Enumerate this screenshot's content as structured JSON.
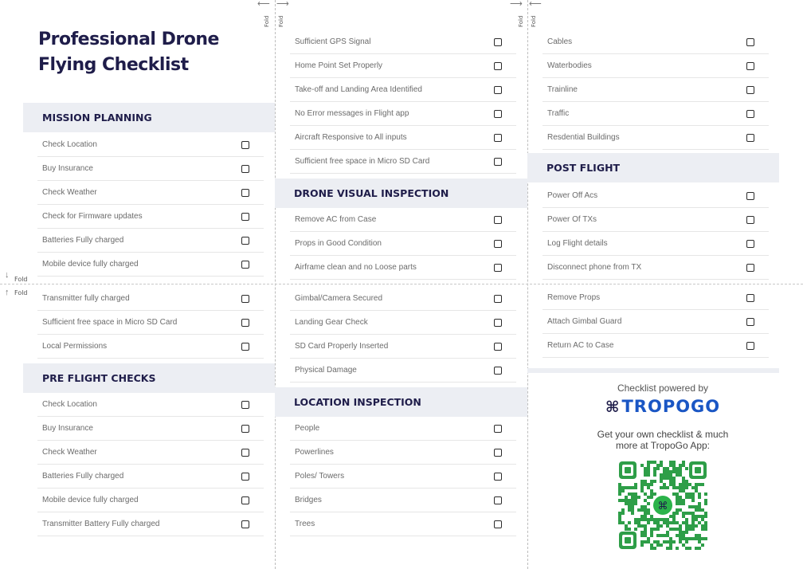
{
  "title": "Professional Drone Flying Checklist",
  "fold_label": "Fold",
  "accent_colors": {
    "title": "#1f1d4a",
    "brand": "#1a56c4",
    "qr": "#2e9e48",
    "qr_center": "#2bb34a"
  },
  "sections": {
    "mission_planning": {
      "heading": "MISSION PLANNING",
      "items": [
        "Check Location",
        "Buy Insurance",
        "Check Weather",
        "Check for Firmware updates",
        "Batteries Fully charged",
        "Mobile device fully charged",
        "Transmitter fully charged",
        "Sufficient free space in Micro SD Card",
        "Local Permissions"
      ]
    },
    "pre_flight": {
      "heading": "PRE FLIGHT CHECKS",
      "items": [
        "Check Location",
        "Buy Insurance",
        "Check Weather",
        "Batteries Fully charged",
        "Mobile device fully charged",
        "Transmitter Battery Fully charged"
      ]
    },
    "pre_flight_continued": {
      "items": [
        "Sufficient GPS Signal",
        "Home Point Set Properly",
        "Take-off and Landing Area Identified",
        "No Error messages in Flight app",
        "Aircraft Responsive to All inputs",
        "Sufficient free space in Micro SD Card"
      ]
    },
    "drone_visual": {
      "heading": "DRONE VISUAL INSPECTION",
      "items": [
        "Remove AC from Case",
        "Props in Good Condition",
        "Airframe clean and no Loose parts",
        "Gimbal/Camera Secured",
        "Landing Gear Check",
        "SD Card Properly Inserted",
        "Physical Damage"
      ]
    },
    "location": {
      "heading": "LOCATION INSPECTION",
      "items": [
        "People",
        "Powerlines",
        "Poles/ Towers",
        "Bridges",
        "Trees"
      ]
    },
    "location_continued": {
      "items": [
        "Cables",
        "Waterbodies",
        "Trainline",
        "Traffic",
        "Resdential Buildings"
      ]
    },
    "post_flight": {
      "heading": "POST FLIGHT",
      "items": [
        "Power Off Acs",
        "Power Of TXs",
        "Log Flight details",
        "Disconnect phone from TX",
        "Remove Props",
        "Attach Gimbal Guard",
        "Return AC to Case"
      ]
    }
  },
  "promo": {
    "powered_by": "Checklist powered by",
    "brand_icon": "⌘",
    "brand_name": "TROPOGO",
    "cta": "Get your own checklist & much more at TropoGo App:",
    "qr_icon": "qr-code-icon"
  }
}
